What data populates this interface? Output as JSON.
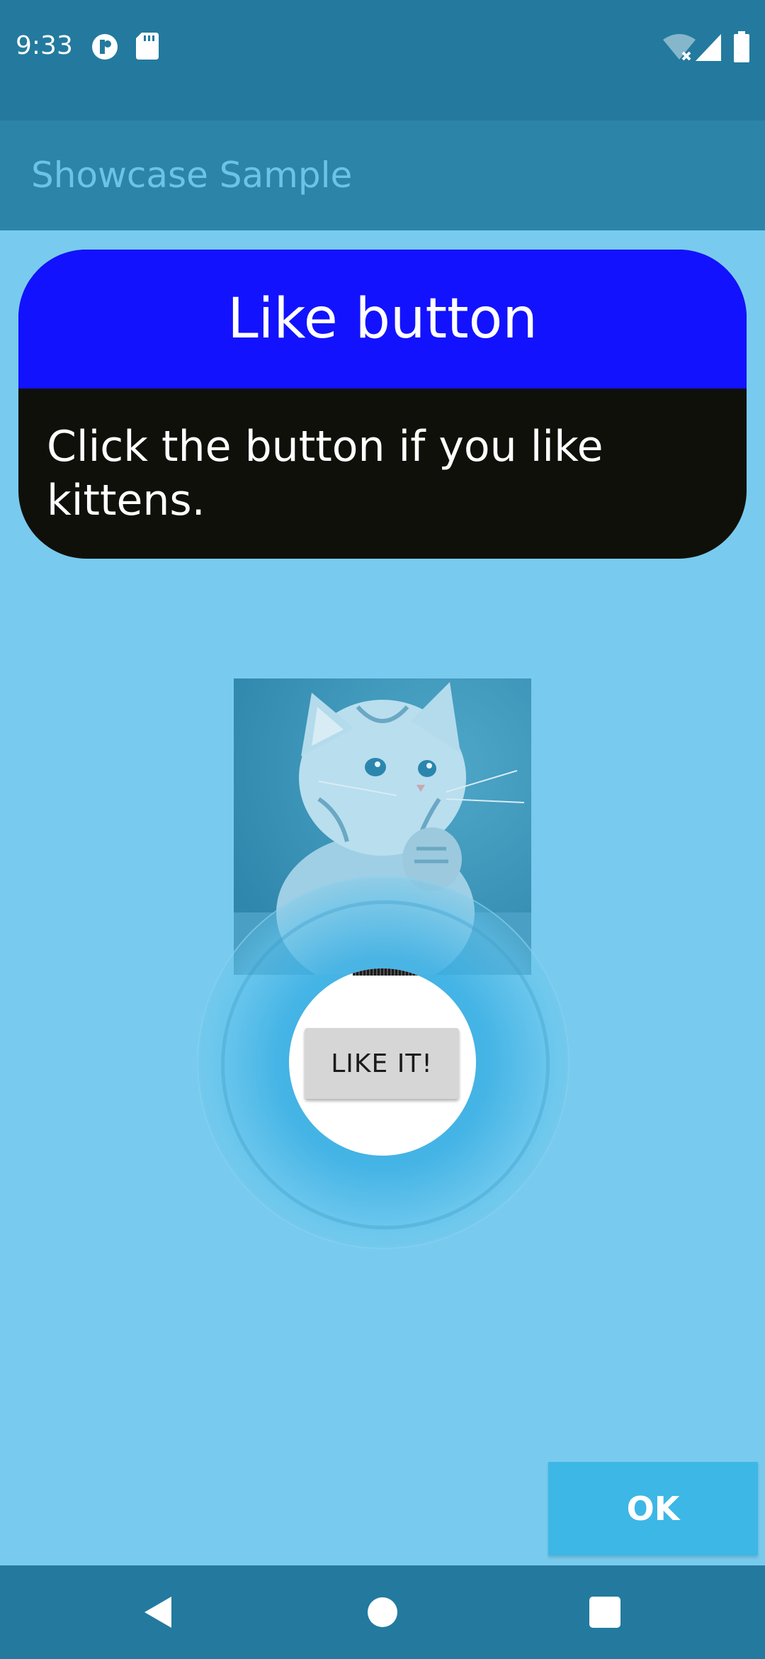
{
  "status_bar": {
    "time": "9:33",
    "icons": [
      "vpn-key-icon",
      "sd-card-icon",
      "wifi-off-icon",
      "cell-signal-icon",
      "battery-icon"
    ]
  },
  "app_bar": {
    "title": "Showcase Sample"
  },
  "tooltip": {
    "title": "Like button",
    "description": "Click the button if you like kittens.",
    "colors": {
      "header": "#1212ff",
      "body": "#10100a"
    }
  },
  "content": {
    "image_subject": "kitten-photo",
    "like_button_label": "LIKE IT!"
  },
  "showcase": {
    "dismiss_label": "OK",
    "overlay_color": "#78cbee"
  },
  "nav_bar": {
    "buttons": [
      "back-icon",
      "home-icon",
      "recents-icon"
    ]
  }
}
